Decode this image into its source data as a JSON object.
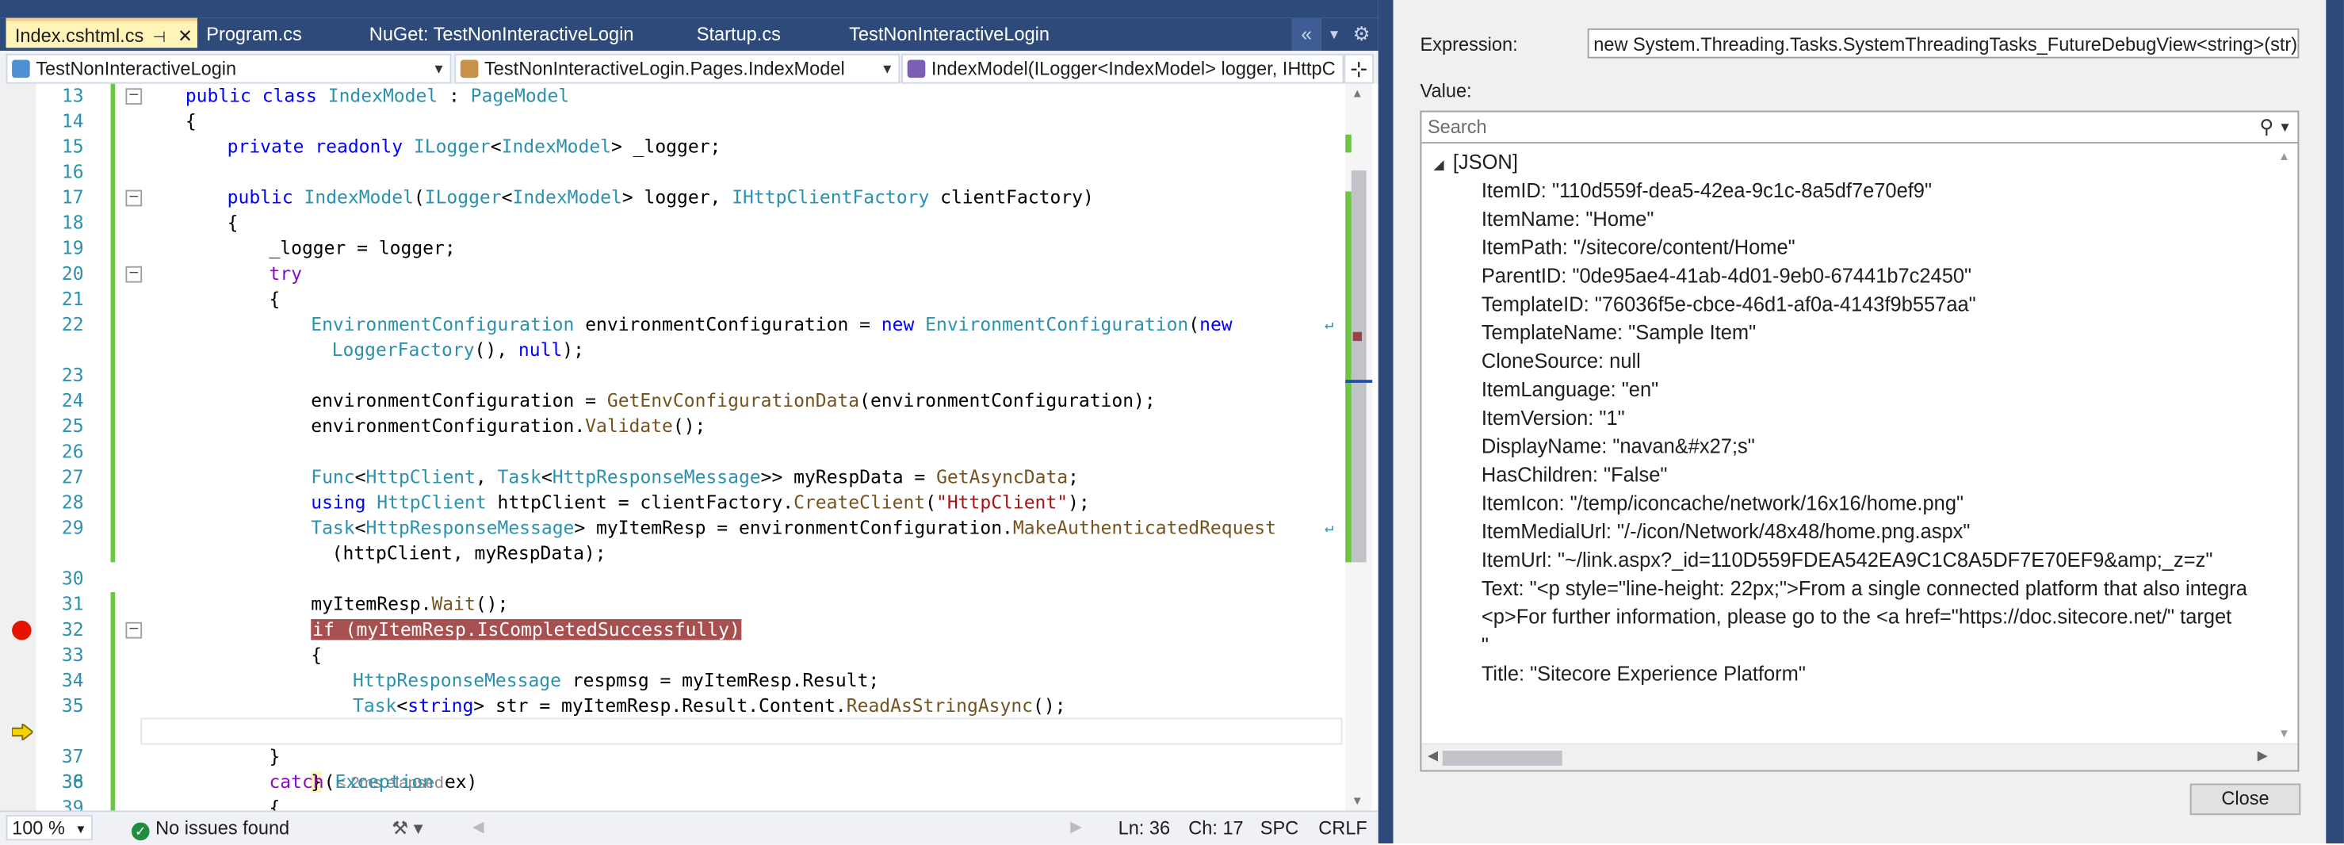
{
  "tabs": [
    {
      "label": "Index.cshtml.cs",
      "active": true
    },
    {
      "label": "Program.cs"
    },
    {
      "label": "NuGet: TestNonInteractiveLogin"
    },
    {
      "label": "Startup.cs"
    },
    {
      "label": "TestNonInteractiveLogin"
    }
  ],
  "nav": {
    "project": "TestNonInteractiveLogin",
    "class": "TestNonInteractiveLogin.Pages.IndexModel",
    "member": "IndexModel(ILogger<IndexModel> logger, IHttpC"
  },
  "code_lines": [
    {
      "n": "13",
      "text": "public class IndexModel : PageModel"
    },
    {
      "n": "14",
      "text": "{"
    },
    {
      "n": "15",
      "text": "private readonly ILogger<IndexModel> _logger;"
    },
    {
      "n": "16",
      "text": ""
    },
    {
      "n": "17",
      "text": "public IndexModel(ILogger<IndexModel> logger, IHttpClientFactory clientFactory)"
    },
    {
      "n": "18",
      "text": "{"
    },
    {
      "n": "19",
      "text": "_logger = logger;"
    },
    {
      "n": "20",
      "text": "try"
    },
    {
      "n": "21",
      "text": "{"
    },
    {
      "n": "22",
      "text": "EnvironmentConfiguration environmentConfiguration = new EnvironmentConfiguration(new"
    },
    {
      "n": "",
      "text": "LoggerFactory(), null);"
    },
    {
      "n": "23",
      "text": ""
    },
    {
      "n": "24",
      "text": "environmentConfiguration = GetEnvConfigurationData(environmentConfiguration);"
    },
    {
      "n": "25",
      "text": "environmentConfiguration.Validate();"
    },
    {
      "n": "26",
      "text": ""
    },
    {
      "n": "27",
      "text": "Func<HttpClient, Task<HttpResponseMessage>> myRespData = GetAsyncData;"
    },
    {
      "n": "28",
      "text": "using HttpClient httpClient = clientFactory.CreateClient(\"HttpClient\");"
    },
    {
      "n": "29",
      "text": "Task<HttpResponseMessage> myItemResp = environmentConfiguration.MakeAuthenticatedRequest"
    },
    {
      "n": "",
      "text": "(httpClient, myRespData);"
    },
    {
      "n": "30",
      "text": ""
    },
    {
      "n": "31",
      "text": "myItemResp.Wait();"
    },
    {
      "n": "32",
      "text": "if (myItemResp.IsCompletedSuccessfully)"
    },
    {
      "n": "33",
      "text": "{"
    },
    {
      "n": "34",
      "text": "HttpResponseMessage respmsg = myItemResp.Result;"
    },
    {
      "n": "35",
      "text": "Task<string> str = myItemResp.Result.Content.ReadAsStringAsync();"
    },
    {
      "n": "36",
      "text": "}"
    },
    {
      "n": "37",
      "text": "}"
    },
    {
      "n": "38",
      "text": "catch(Exception ex)"
    },
    {
      "n": "39",
      "text": "{"
    }
  ],
  "elapsed": "≤ 2ms elapsed",
  "status": {
    "zoom": "100 %",
    "issues": "No issues found",
    "ln": "Ln: 36",
    "ch": "Ch: 17",
    "spc": "SPC",
    "crlf": "CRLF"
  },
  "dialog": {
    "expression_label": "Expression:",
    "expression_value": "new System.Threading.Tasks.SystemThreadingTasks_FutureDebugView<string>(str).Result",
    "value_label": "Value:",
    "search_placeholder": "Search",
    "root_label": "[JSON]",
    "json_entries": [
      "ItemID: \"110d559f-dea5-42ea-9c1c-8a5df7e70ef9\"",
      "ItemName: \"Home\"",
      "ItemPath: \"/sitecore/content/Home\"",
      "ParentID: \"0de95ae4-41ab-4d01-9eb0-67441b7c2450\"",
      "TemplateID: \"76036f5e-cbce-46d1-af0a-4143f9b557aa\"",
      "TemplateName: \"Sample Item\"",
      "CloneSource: null",
      "ItemLanguage: \"en\"",
      "ItemVersion: \"1\"",
      "DisplayName: \"navan&#x27;s\"",
      "HasChildren: \"False\"",
      "ItemIcon: \"/temp/iconcache/network/16x16/home.png\"",
      "ItemMedialUrl: \"/-/icon/Network/48x48/home.png.aspx\"",
      "ItemUrl: \"~/link.aspx?_id=110D559FDEA542EA9C1C8A5DF7E70EF9&amp;_z=z\"",
      "Text: \"<p style=\"line-height: 22px;\">From a single connected platform that also integra",
      "<p>For further information, please go to the <a href=\"https://doc.sitecore.net/\" target",
      "\"",
      "Title: \"Sitecore Experience Platform\""
    ],
    "close_label": "Close"
  }
}
